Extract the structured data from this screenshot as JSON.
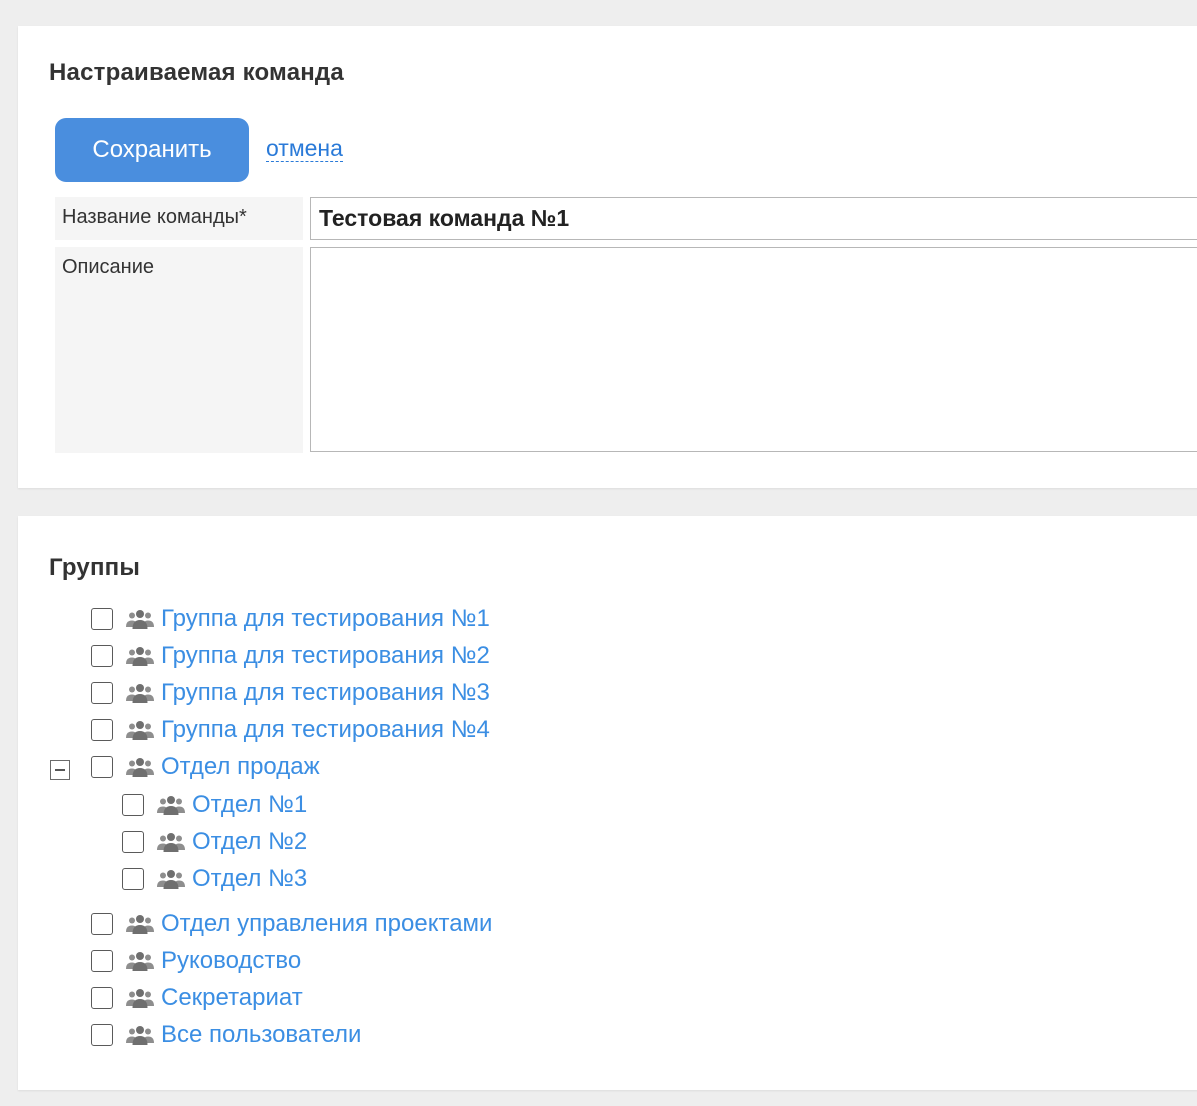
{
  "form": {
    "title": "Настраиваемая команда",
    "save_label": "Сохранить",
    "cancel_label": "отмена",
    "name_label": "Название команды*",
    "name_value": "Тестовая команда №1",
    "description_label": "Описание",
    "description_value": ""
  },
  "groups": {
    "title": "Группы",
    "items": [
      {
        "label": "Группа для тестирования №1",
        "checked": false
      },
      {
        "label": "Группа для тестирования №2",
        "checked": false
      },
      {
        "label": "Группа для тестирования №3",
        "checked": false
      },
      {
        "label": "Группа для тестирования №4",
        "checked": false
      },
      {
        "label": "Отдел продаж",
        "checked": false,
        "expanded": true,
        "children": [
          {
            "label": "Отдел №1",
            "checked": false
          },
          {
            "label": "Отдел №2",
            "checked": false
          },
          {
            "label": "Отдел №3",
            "checked": false
          }
        ]
      },
      {
        "label": "Отдел управления проектами",
        "checked": false
      },
      {
        "label": "Руководство",
        "checked": false
      },
      {
        "label": "Секретариат",
        "checked": false
      },
      {
        "label": "Все пользователи",
        "checked": false
      }
    ]
  },
  "icons": {
    "group": "users-group-icon",
    "expand_toggle": "minus-square-icon"
  },
  "colors": {
    "primary_button": "#4a8ede",
    "link": "#3b8ee3",
    "page_background": "#eeeeee"
  }
}
